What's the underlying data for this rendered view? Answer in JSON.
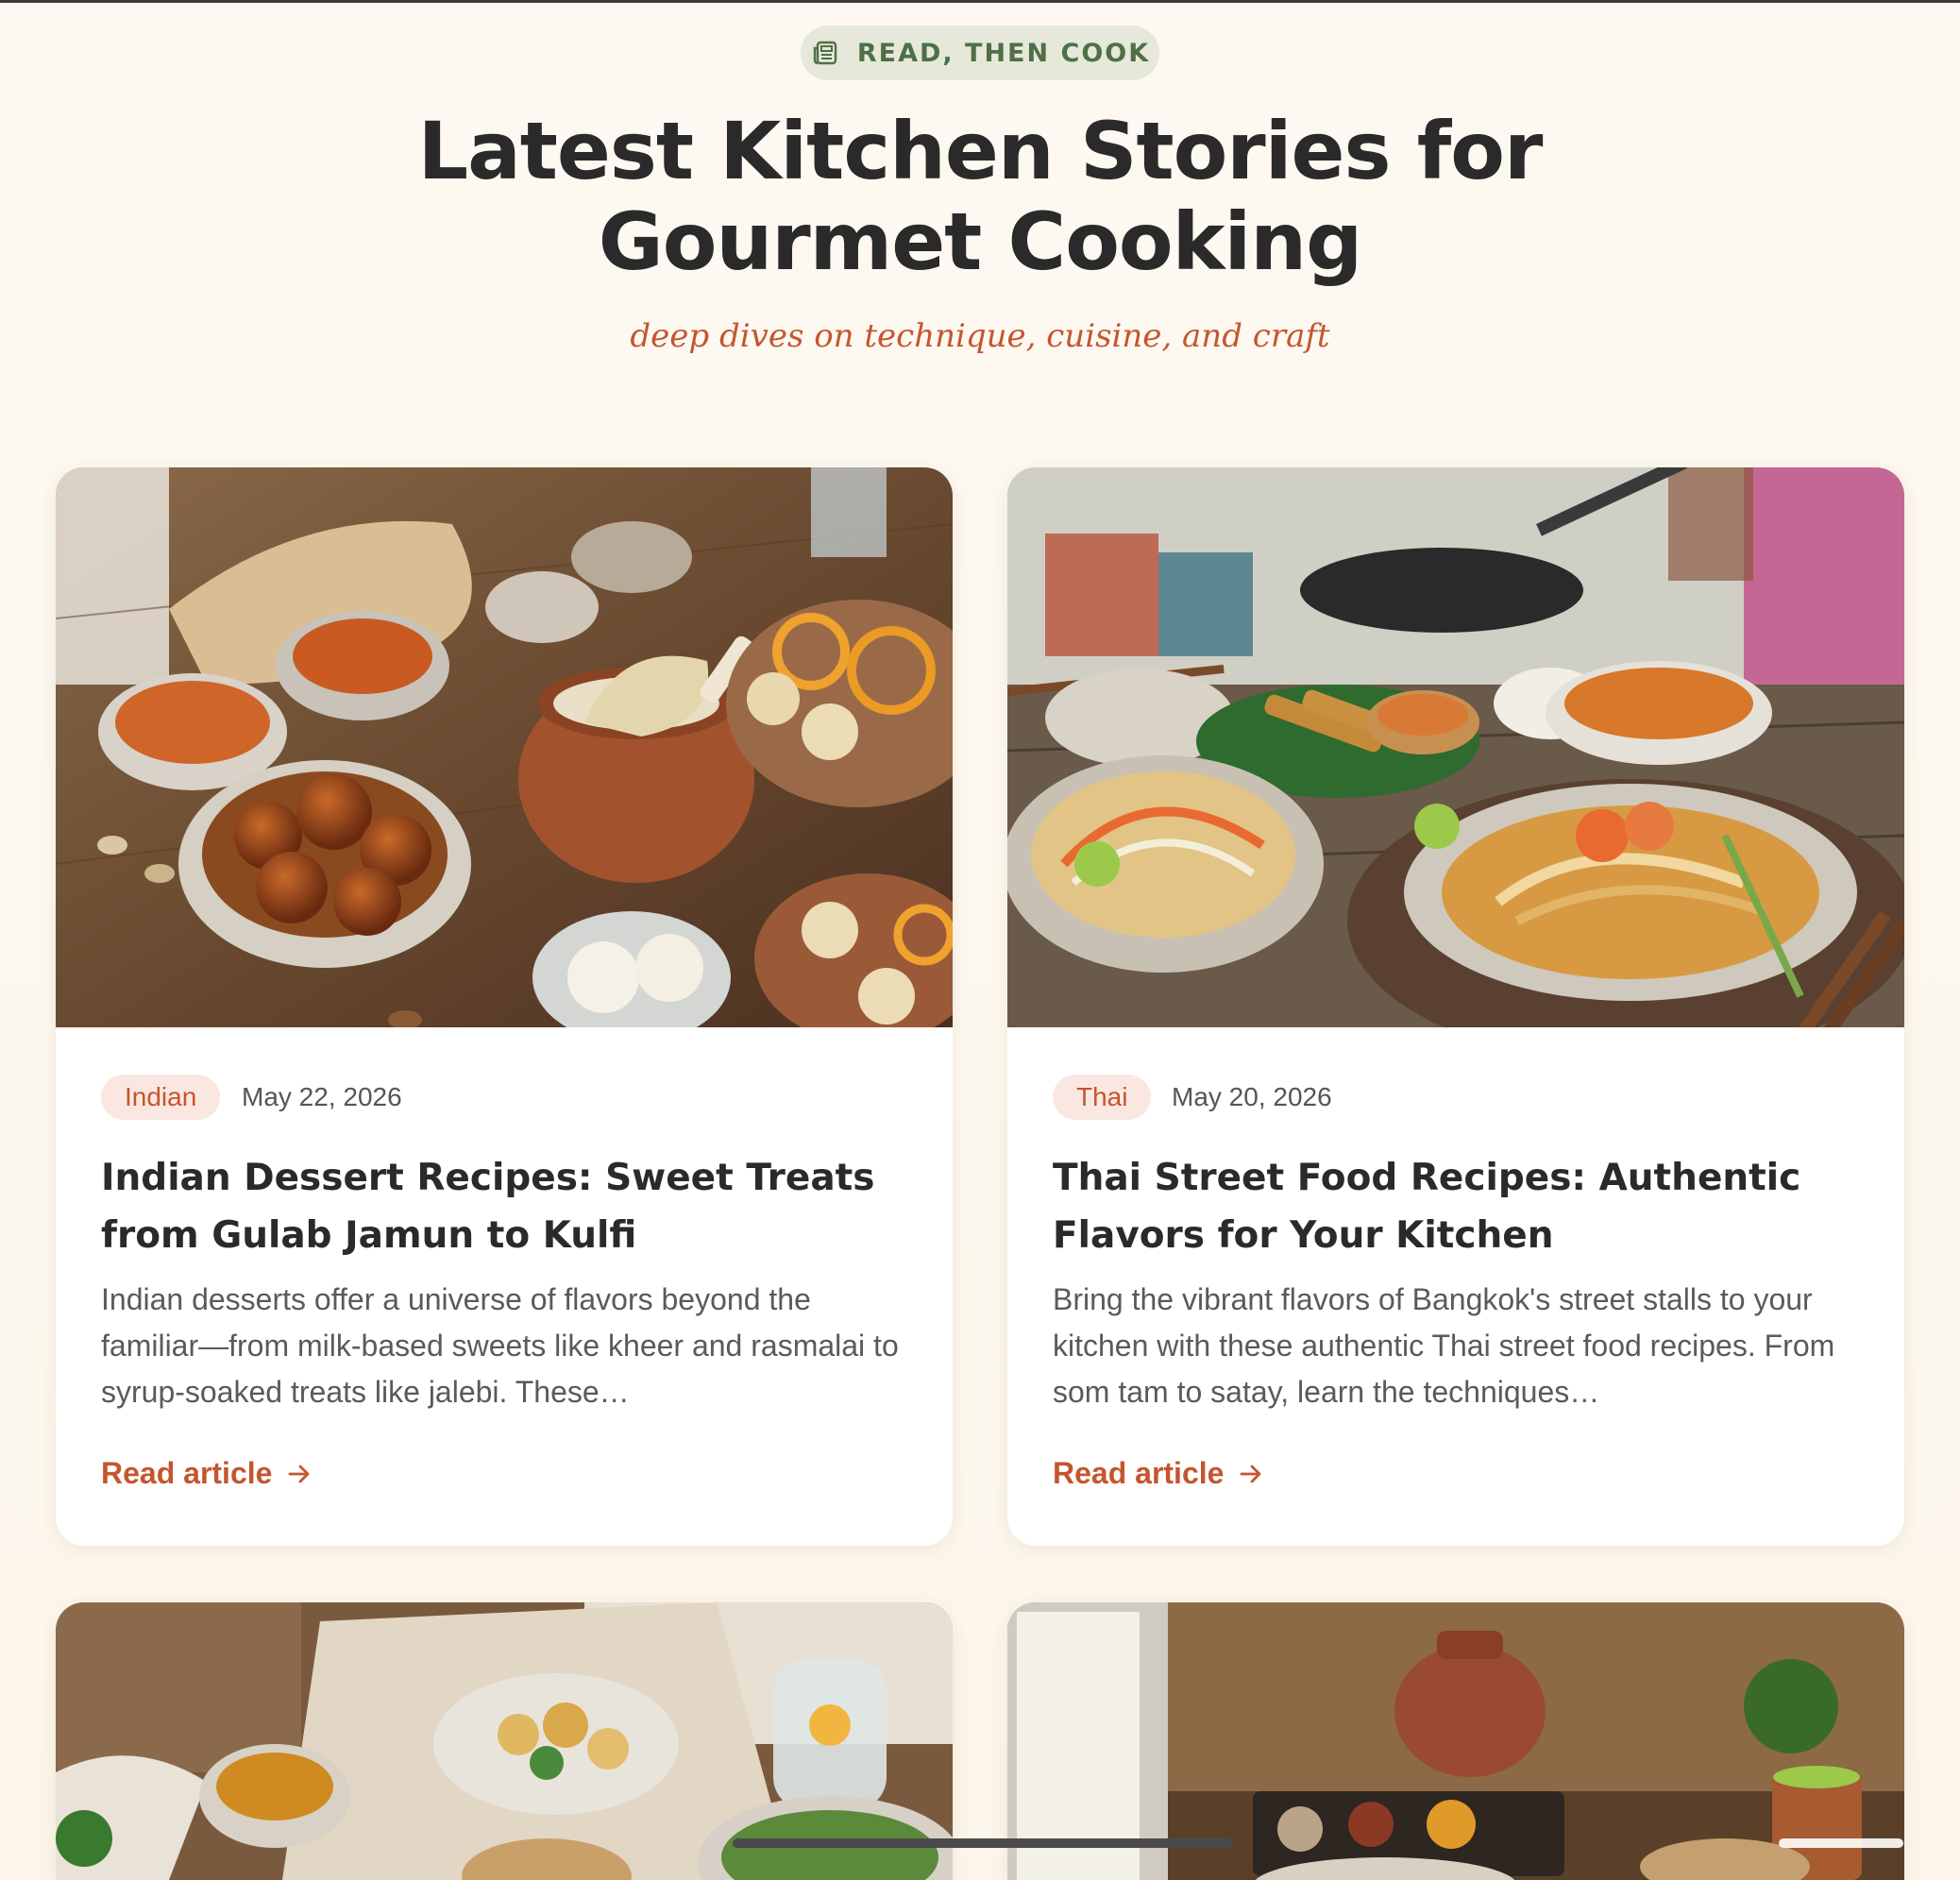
{
  "header": {
    "eyebrow_icon": "newspaper-icon",
    "eyebrow": "READ, THEN COOK",
    "title": "Latest Kitchen Stories for Gourmet Cooking",
    "subtitle": "deep dives on technique, cuisine, and craft"
  },
  "colors": {
    "accent": "#c4562f",
    "eyebrow_text": "#4f7046",
    "eyebrow_bg": "#e6e8da",
    "tag_bg": "#fbe7e1",
    "page_bg": "#fdf9f2"
  },
  "articles": [
    {
      "image_alt": "Indian desserts spread: gulab jamun, kulfi, jalebi and rasgulla on a wooden table",
      "category": "Indian",
      "date": "May 22, 2026",
      "title": "Indian Dessert Recipes: Sweet Treats from Gulab Jamun to Kulfi",
      "excerpt": "Indian desserts offer a universe of flavors beyond the familiar—from milk-based sweets like kheer and rasmalai to syrup-soaked treats like jalebi. These…",
      "link_label": "Read article",
      "link_icon": "arrow-right-icon"
    },
    {
      "image_alt": "Thai street food: pad thai with shrimp, som tam, satay skewers at a market stall",
      "category": "Thai",
      "date": "May 20, 2026",
      "title": "Thai Street Food Recipes: Authentic Flavors for Your Kitchen",
      "excerpt": "Bring the vibrant flavors of Bangkok's street stalls to your kitchen with these authentic Thai street food recipes. From som tam to satay, learn the techniques…",
      "link_label": "Read article",
      "link_icon": "arrow-right-icon"
    },
    {
      "image_alt": "Table with roasted cauliflower, lentils, flatbread, salad and a pitcher of lemon water"
    },
    {
      "image_alt": "Rustic table with spice tray, clay pot, flatbreads and a copper cup by a window"
    }
  ]
}
